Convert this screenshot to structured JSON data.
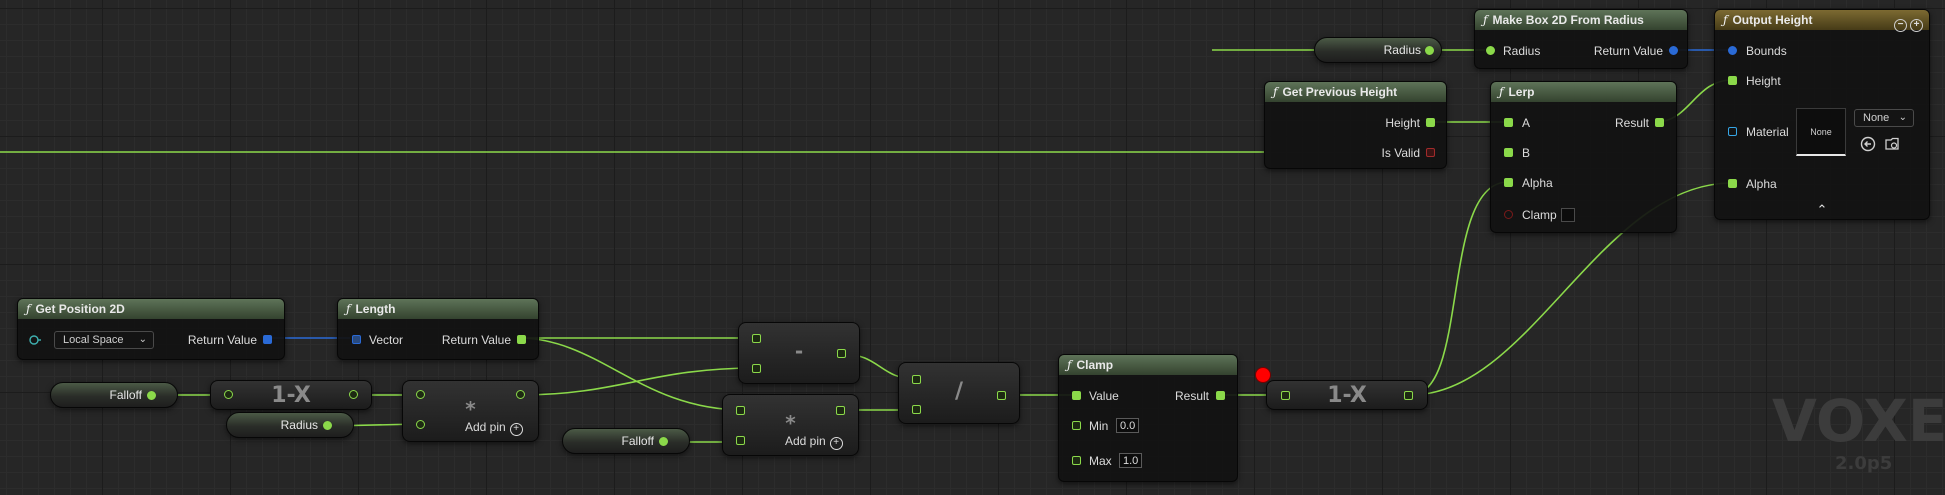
{
  "colors": {
    "float_pin": "#8bd94a",
    "struct_pin": "#2a6ad6",
    "bool_pin": "#a22b2b",
    "function_header": "#5e7358",
    "output_header": "#7c6a32",
    "breakpoint": "#ff0000"
  },
  "icons": {
    "function": "ƒ",
    "collapse": "−",
    "add": "+",
    "chevron_down": "⌄",
    "chevron_up": "⌃"
  },
  "nodes": {
    "get_position_2d": {
      "title": "Get Position 2D",
      "space_dropdown": "Local Space",
      "return_value": "Return Value"
    },
    "length": {
      "title": "Length",
      "input": "Vector",
      "return_value": "Return Value"
    },
    "falloff_var_1": {
      "label": "Falloff"
    },
    "radius_var_1": {
      "label": "Radius"
    },
    "falloff_var_2": {
      "label": "Falloff"
    },
    "radius_var_top": {
      "label": "Radius"
    },
    "one_minus_x_1": {
      "title": "1-X"
    },
    "one_minus_x_2": {
      "title": "1-X"
    },
    "multiply_1": {
      "title": "*",
      "add_pin": "Add pin"
    },
    "multiply_2": {
      "title": "*",
      "add_pin": "Add pin"
    },
    "subtract": {
      "title": "-"
    },
    "divide": {
      "title": "/"
    },
    "clamp": {
      "title": "Clamp",
      "value": "Value",
      "min": "Min",
      "min_value": "0.0",
      "max": "Max",
      "max_value": "1.0",
      "result": "Result"
    },
    "get_previous_height": {
      "title": "Get Previous Height",
      "height": "Height",
      "is_valid": "Is Valid"
    },
    "lerp": {
      "title": "Lerp",
      "a": "A",
      "b": "B",
      "alpha": "Alpha",
      "clamp": "Clamp",
      "result": "Result"
    },
    "make_box_2d": {
      "title": "Make Box 2D From Radius",
      "radius": "Radius",
      "return_value": "Return Value"
    },
    "output_height": {
      "title": "Output Height",
      "bounds": "Bounds",
      "height": "Height",
      "material": "Material",
      "material_thumb": "None",
      "material_dropdown": "None",
      "alpha": "Alpha"
    }
  },
  "watermark": {
    "title": "VOXEL",
    "version": "2.0p5"
  }
}
